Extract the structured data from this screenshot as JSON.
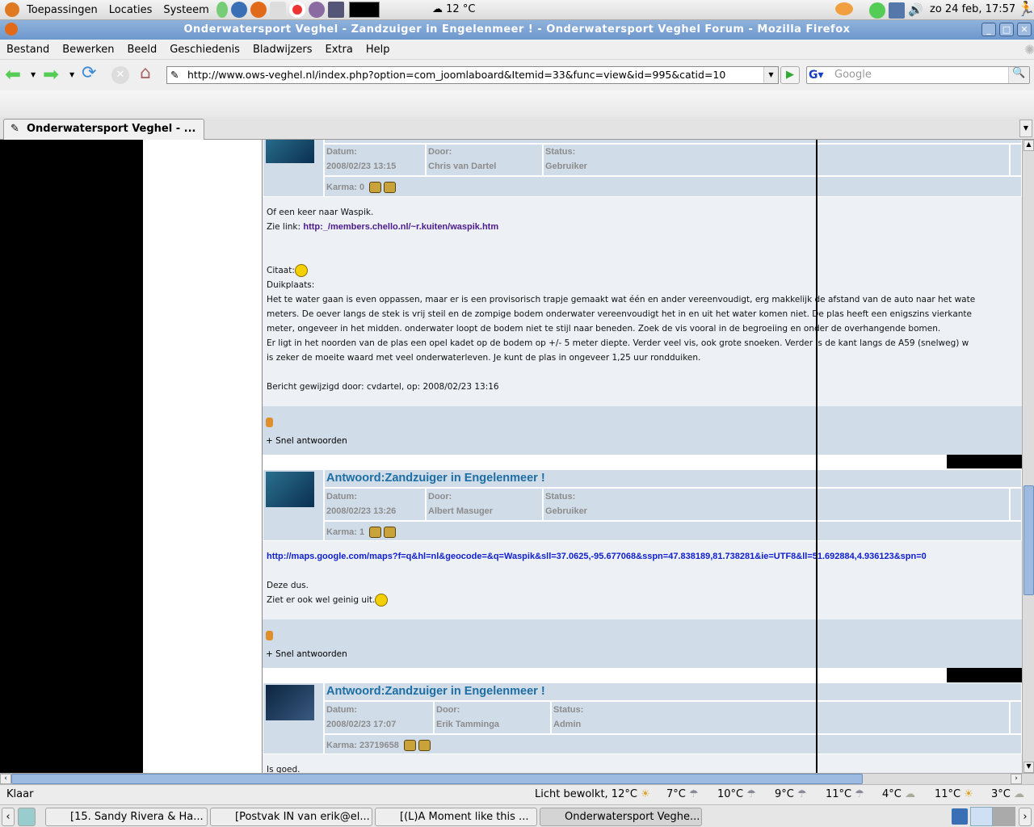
{
  "panel": {
    "menus": [
      "Toepassingen",
      "Locaties",
      "Systeem"
    ],
    "weather": "12 °C",
    "clock": "zo 24 feb, 17:57"
  },
  "window": {
    "title": "Onderwatersport Veghel - Zandzuiger in Engelenmeer ! - Onderwatersport Veghel Forum - Mozilla Firefox"
  },
  "menubar": [
    "Bestand",
    "Bewerken",
    "Beeld",
    "Geschiedenis",
    "Bladwijzers",
    "Extra",
    "Help"
  ],
  "nav": {
    "url": "http://www.ows-veghel.nl/index.php?option=com_joomlaboard&Itemid=33&func=view&id=995&catid=10",
    "search_placeholder": "Google"
  },
  "tab": {
    "label": "Onderwatersport Veghel - ..."
  },
  "labels": {
    "datum": "Datum:",
    "door": "Door:",
    "status": "Status:",
    "quote": "Citaat:",
    "reply": "+ Snel antwoorden"
  },
  "posts": [
    {
      "date": "2008/02/23 13:15",
      "author": "Chris van Dartel",
      "status": "Gebruiker",
      "karma": "Karma: 0",
      "lines": [
        "Of een keer naar Waspik."
      ],
      "link_prefix": "Zie link: ",
      "link": "http:_/members.chello.nl/~r.kuiten/waspik.htm",
      "quote_title": "Duikplaats:",
      "quote_lines": [
        "Het te water gaan is even oppassen, maar er is een provisorisch trapje gemaakt wat één en ander vereenvoudigt, erg makkelijk de afstand van de auto naar het wate",
        "meters. De oever langs de stek is vrij steil en de zompige bodem onderwater vereenvoudigt het in en uit het water komen niet. De plas heeft een enigszins vierkante",
        "meter, ongeveer in het midden. onderwater loopt de bodem niet te stijl naar beneden. Zoek de vis vooral in de begroeiing en onder de overhangende bomen.",
        "Er ligt in het noorden van de plas een opel kadet op de bodem op +/- 5 meter diepte. Verder veel vis, ook grote snoeken. Verder is de kant langs de A59 (snelweg) w",
        "is zeker de moeite waard met veel onderwaterleven. Je kunt de plas in ongeveer 1,25 uur rondduiken."
      ],
      "edited": "Bericht gewijzigd door: cvdartel, op: 2008/02/23 13:16"
    },
    {
      "title": "Antwoord:Zandzuiger in Engelenmeer !",
      "date": "2008/02/23 13:26",
      "author": "Albert Masuger",
      "status": "Gebruiker",
      "karma": "Karma: 1",
      "link": "http://maps.google.com/maps?f=q&hl=nl&geocode=&q=Waspik&sll=37.0625,-95.677068&sspn=47.838189,81.738281&ie=UTF8&ll=51.692884,4.936123&spn=0",
      "lines": [
        "Deze dus.",
        "Ziet er ook wel geinig uit."
      ]
    },
    {
      "title": "Antwoord:Zandzuiger in Engelenmeer !",
      "date": "2008/02/23 17:07",
      "author": "Erik Tamminga",
      "status": "Admin",
      "karma": "Karma: 23719658",
      "lines": [
        "Is goed."
      ]
    }
  ],
  "status": {
    "text": "Klaar",
    "weather": [
      "Licht bewolkt, 12°C",
      "7°C",
      "10°C",
      "9°C",
      "11°C",
      "4°C",
      "11°C",
      "3°C"
    ]
  },
  "taskbar": [
    "[15. Sandy Rivera & Ha...",
    "[Postvak IN van erik@el...",
    "[(L)A Moment like this ...",
    "Onderwatersport Veghe..."
  ]
}
